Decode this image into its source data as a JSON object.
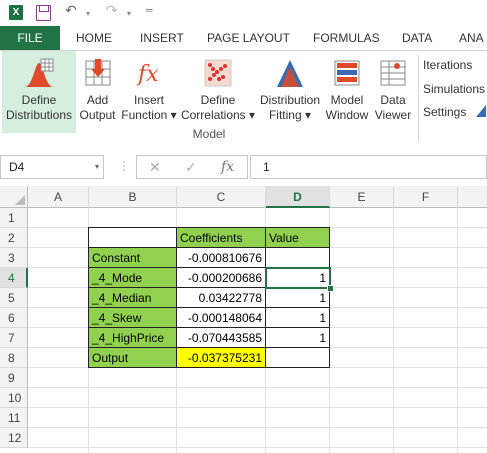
{
  "qat": {
    "app_icon": "X",
    "undo_icon": "undo-icon",
    "redo_icon": "redo-icon",
    "customize_icon": "customize-icon"
  },
  "tabs": [
    "FILE",
    "HOME",
    "INSERT",
    "PAGE LAYOUT",
    "FORMULAS",
    "DATA",
    "ANA"
  ],
  "ribbon": {
    "buttons": [
      {
        "l1": "Define",
        "l2": "Distributions"
      },
      {
        "l1": "Add",
        "l2": "Output"
      },
      {
        "l1": "Insert",
        "l2": "Function ▾"
      },
      {
        "l1": "Define",
        "l2": "Correlations ▾"
      },
      {
        "l1": "Distribution",
        "l2": "Fitting ▾"
      },
      {
        "l1": "Model",
        "l2": "Window"
      },
      {
        "l1": "Data",
        "l2": "Viewer"
      }
    ],
    "group_label": "Model",
    "side_items": [
      "Iterations",
      "Simulations",
      "Settings"
    ]
  },
  "formula_bar": {
    "name_box": "D4",
    "formula": "1",
    "fx_label": "fx"
  },
  "columns": [
    "A",
    "B",
    "C",
    "D",
    "E",
    "F"
  ],
  "rows": [
    "1",
    "2",
    "3",
    "4",
    "5",
    "6",
    "7",
    "8",
    "9",
    "10",
    "11",
    "12"
  ],
  "table": {
    "headers": {
      "coefficients": "Coefficients",
      "value": "Value"
    },
    "labels": [
      "Constant",
      "_4_Mode",
      "_4_Median",
      "_4_Skew",
      "_4_HighPrice",
      "Output"
    ],
    "coefficients": [
      "-0.000810676",
      "-0.000200686",
      "0.03422778",
      "-0.000148064",
      "-0.070443585",
      "-0.037375231"
    ],
    "values": [
      "",
      "1",
      "1",
      "1",
      "1",
      ""
    ]
  },
  "colors": {
    "excel_green": "#217346",
    "cell_green": "#92d050",
    "cell_yellow": "#ffff00"
  }
}
